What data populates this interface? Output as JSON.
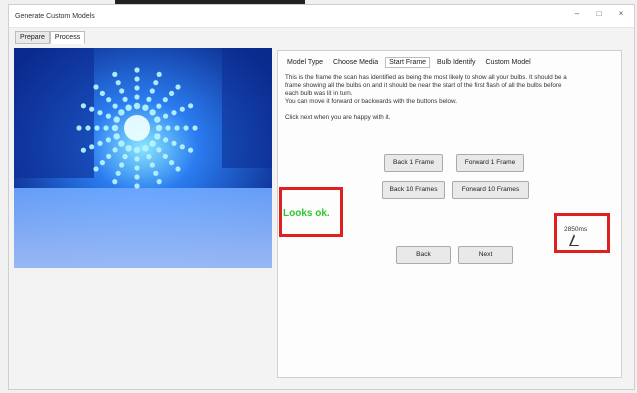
{
  "window": {
    "title": "Generate Custom Models"
  },
  "title_buttons": {
    "minimize": "–",
    "maximize": "□",
    "close": "×"
  },
  "top_tabs": [
    "Prepare",
    "Process"
  ],
  "right_panel": {
    "subtabs": [
      "Model Type",
      "Choose Media",
      "Start Frame",
      "Bulb Identify",
      "Custom Model"
    ],
    "description": [
      "This is the frame the scan has identified as being the most likely to show all your bulbs. It should be a",
      "frame showing all the bulbs on and it should be near the start of the first flash of all the bulbs before",
      "each bulb was lit in turn.",
      "You can move it forward or backwards with the buttons below."
    ],
    "hint": "Click next when you are happy with it.",
    "buttons": {
      "back1": "Back 1 Frame",
      "forward1": "Forward 1 Frame",
      "back10": "Back 10 Frames",
      "forward10": "Forward 10 Frames",
      "back": "Back",
      "next": "Next"
    },
    "status": "Looks ok.",
    "timecode": "2850ms"
  },
  "colors": {
    "accent_red": "#e02020",
    "ok_green": "#2dc72d",
    "preview_blue": "#1b5fd0"
  }
}
